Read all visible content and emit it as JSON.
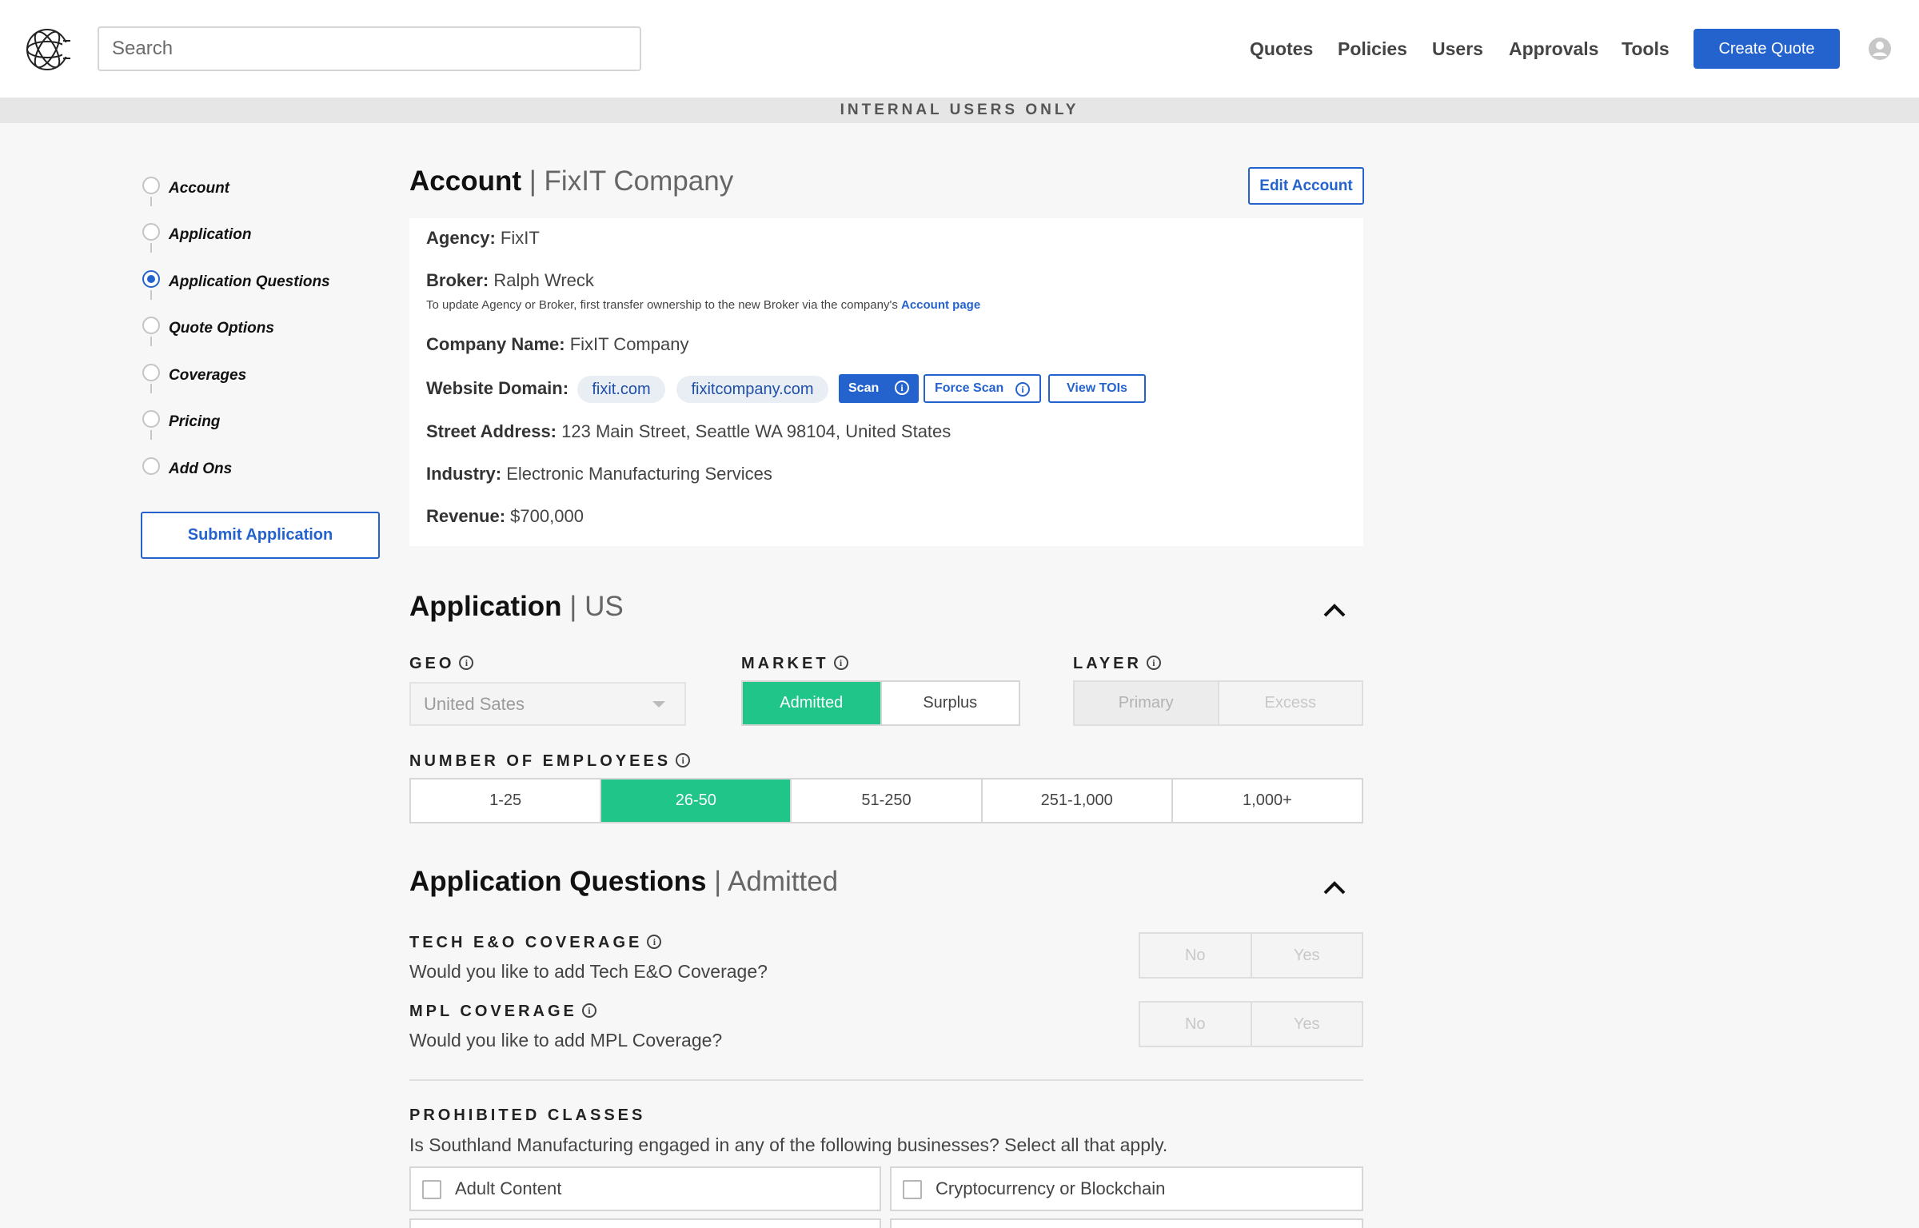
{
  "header": {
    "search_placeholder": "Search",
    "nav": [
      "Quotes",
      "Policies",
      "Users",
      "Approvals",
      "Tools"
    ],
    "create_button": "Create Quote"
  },
  "banner": "INTERNAL USERS ONLY",
  "stepper": {
    "steps": [
      "Account",
      "Application",
      "Application Questions",
      "Quote Options",
      "Coverages",
      "Pricing",
      "Add Ons"
    ],
    "active_index": 2,
    "submit_button": "Submit  Application"
  },
  "account": {
    "title": "Account",
    "subtitle": "FixIT Company",
    "edit_button": "Edit Account",
    "agency_label": "Agency:",
    "agency": "FixIT",
    "broker_label": "Broker:",
    "broker": "Ralph Wreck",
    "broker_note": "To update Agency or Broker, first transfer ownership to the new Broker via the company's ",
    "broker_note_link": "Account page",
    "company_label": "Company Name:",
    "company": "FixIT Company",
    "website_label": "Website Domain:",
    "domains": [
      "fixit.com",
      "fixitcompany.com"
    ],
    "scan_button": "Scan",
    "force_scan_button": "Force Scan",
    "view_tois_button": "View TOIs",
    "address_label": "Street Address:",
    "address": "123 Main Street, Seattle WA 98104, United States",
    "industry_label": "Industry:",
    "industry": "Electronic Manufacturing Services",
    "revenue_label": "Revenue:",
    "revenue": "$700,000"
  },
  "application": {
    "title": "Application",
    "subtitle": "US",
    "geo_label": "GEO",
    "geo_value": "United Sates",
    "market_label": "MARKET",
    "market_options": [
      "Admitted",
      "Surplus"
    ],
    "market_selected": "Admitted",
    "layer_label": "LAYER",
    "layer_options": [
      "Primary",
      "Excess"
    ],
    "employees_label": "NUMBER OF EMPLOYEES",
    "employee_options": [
      "1-25",
      "26-50",
      "51-250",
      "251-1,000",
      "1,000+"
    ],
    "employees_selected": "26-50"
  },
  "questions": {
    "title": "Application Questions",
    "subtitle": "Admitted",
    "tech_label": "TECH E&O COVERAGE",
    "tech_question": "Would you like to add Tech E&O Coverage?",
    "mpl_label": "MPL COVERAGE",
    "mpl_question": "Would you like to add MPL Coverage?",
    "no_label": "No",
    "yes_label": "Yes",
    "prohibited_label": "PROHIBITED CLASSES",
    "prohibited_question": "Is Southland Manufacturing engaged in any of the following businesses? Select all that apply.",
    "prohibited_options": [
      "Adult Content",
      "Cryptocurrency or Blockchain"
    ]
  },
  "colors": {
    "primary": "#2463cd",
    "selected_green": "#1fc589"
  },
  "icons": [
    "logo-icon",
    "user-avatar-icon",
    "info-icon",
    "chevron-up-icon",
    "caret-down-icon"
  ]
}
